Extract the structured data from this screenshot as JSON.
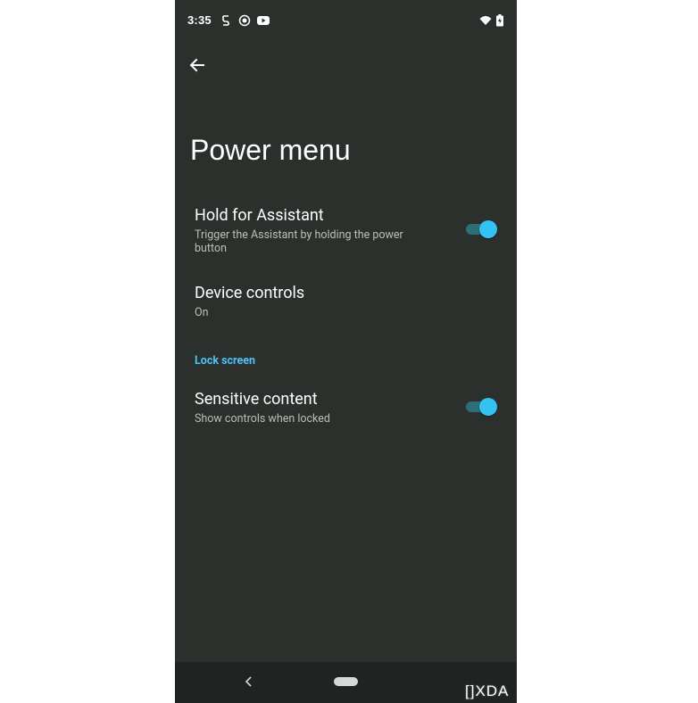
{
  "status_bar": {
    "time": "3:35",
    "left_icons": [
      "settings-status-icon",
      "screen-record-icon",
      "youtube-icon"
    ],
    "right_icons": [
      "wifi-icon",
      "battery-charging-icon"
    ]
  },
  "header": {
    "back_icon": "arrow-back-icon",
    "title": "Power menu"
  },
  "settings": [
    {
      "title": "Hold for Assistant",
      "subtitle": "Trigger the Assistant by holding the power button",
      "toggle": true
    },
    {
      "title": "Device controls",
      "subtitle": "On",
      "toggle": null
    }
  ],
  "lock_screen": {
    "header": "Lock screen",
    "items": [
      {
        "title": "Sensitive content",
        "subtitle": "Show controls when locked",
        "toggle": true
      }
    ]
  },
  "nav_bar": {
    "back_icon": "nav-back-icon",
    "home_icon": "home-pill-icon"
  },
  "watermark": "[]XDA",
  "colors": {
    "background": "#2b302d",
    "accent": "#33c3f2",
    "section_header": "#4fc3f7",
    "toggle_track": "#2e6e78",
    "navbar": "#1f2321"
  }
}
